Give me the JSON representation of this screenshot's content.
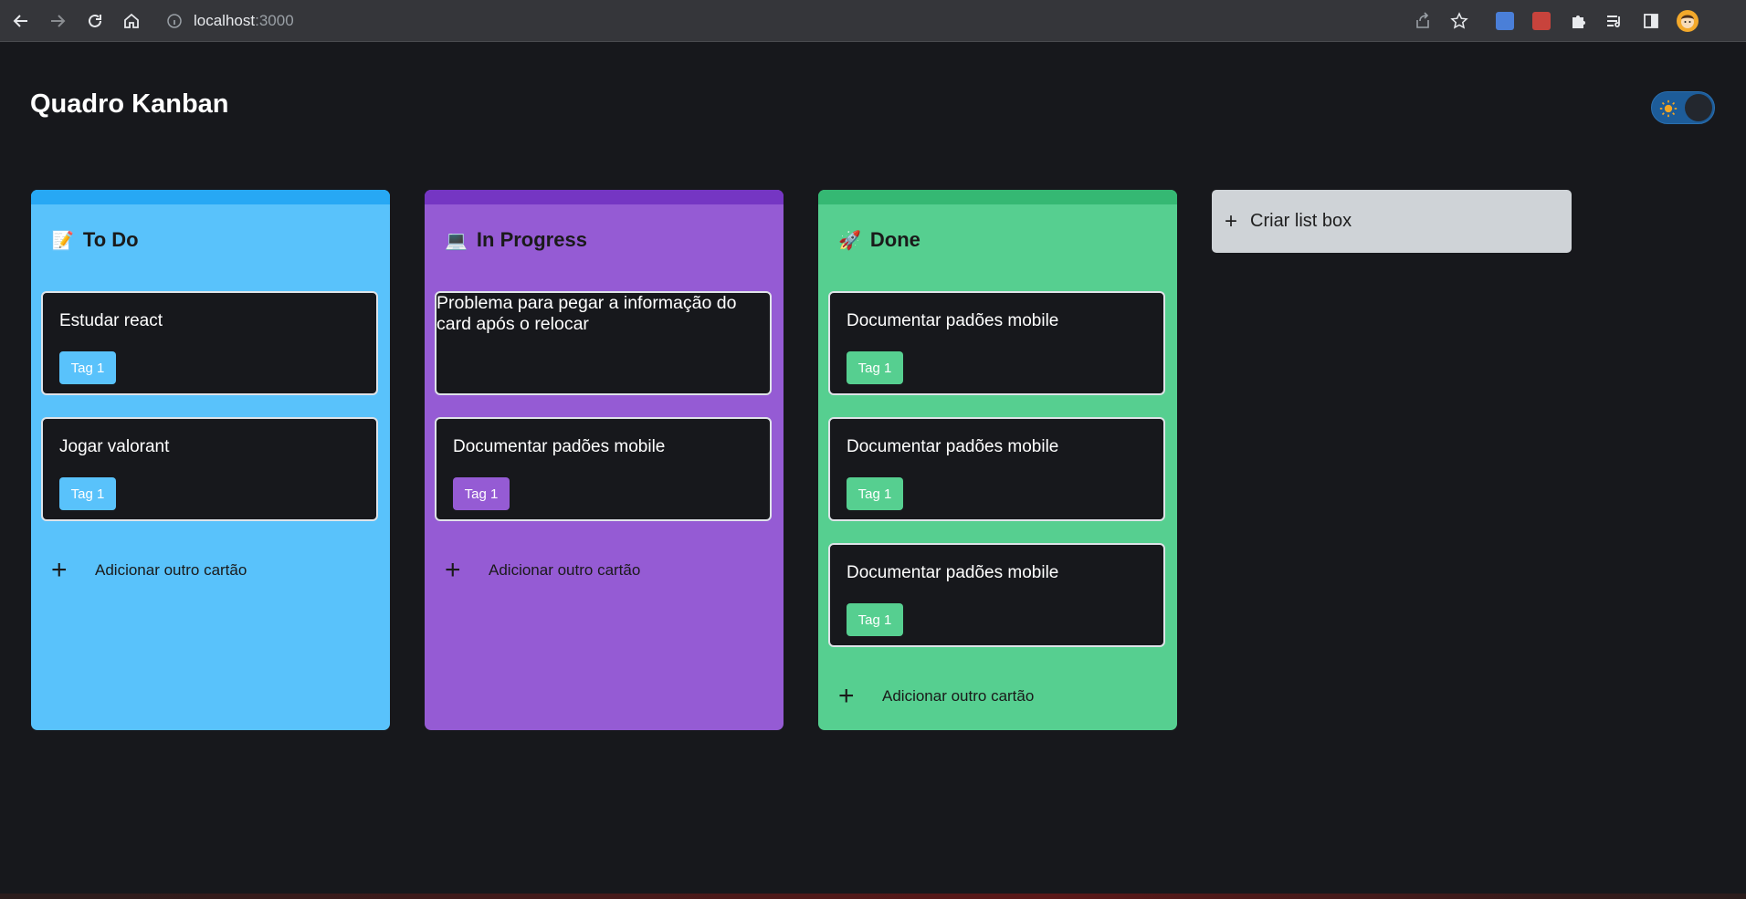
{
  "browser": {
    "host": "localhost",
    "port": ":3000"
  },
  "page": {
    "title": "Quadro Kanban"
  },
  "colors": {
    "todo": "#59c2fb",
    "todo_stripe": "#27a8f4",
    "in_progress": "#955bd4",
    "in_progress_stripe": "#7536c3",
    "done": "#56cf90",
    "done_stripe": "#35b873",
    "new_list": "#cfd3d7"
  },
  "columns": [
    {
      "emoji": "📝",
      "title": "To Do",
      "cards": [
        {
          "title": "Estudar react",
          "tag": "Tag 1"
        },
        {
          "title": "Jogar valorant",
          "tag": "Tag 1"
        }
      ],
      "add_label": "Adicionar outro cartão"
    },
    {
      "emoji": "💻",
      "title": "In Progress",
      "cards": [
        {
          "title": "Problema para pegar a informação do card após o relocar"
        },
        {
          "title": "Documentar padões mobile",
          "tag": "Tag 1"
        }
      ],
      "add_label": "Adicionar outro cartão"
    },
    {
      "emoji": "🚀",
      "title": "Done",
      "cards": [
        {
          "title": "Documentar padões mobile",
          "tag": "Tag 1"
        },
        {
          "title": "Documentar padões mobile",
          "tag": "Tag 1"
        },
        {
          "title": "Documentar padões mobile",
          "tag": "Tag 1"
        }
      ],
      "add_label": "Adicionar outro cartão"
    }
  ],
  "new_list": {
    "label": "Criar list box"
  },
  "icons": {
    "back": "arrow-left-icon",
    "forward": "arrow-right-icon",
    "reload": "reload-icon",
    "home": "home-icon",
    "info": "info-icon",
    "share": "share-icon",
    "bookmark": "star-icon",
    "theme": "sun-icon"
  }
}
